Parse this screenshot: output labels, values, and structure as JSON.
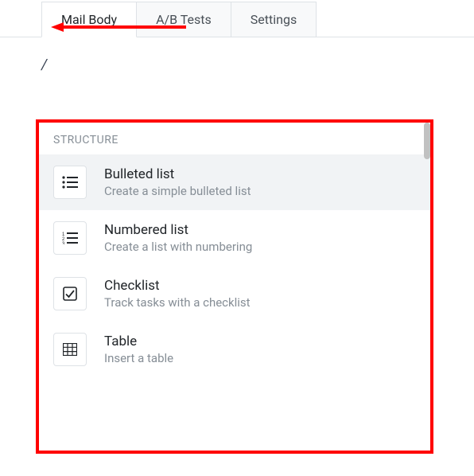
{
  "tabs": {
    "mail_body": "Mail Body",
    "ab_tests": "A/B Tests",
    "settings": "Settings"
  },
  "editor": {
    "slash": "/"
  },
  "popup": {
    "section_label": "STRUCTURE",
    "items": [
      {
        "title": "Bulleted list",
        "desc": "Create a simple bulleted list"
      },
      {
        "title": "Numbered list",
        "desc": "Create a list with numbering"
      },
      {
        "title": "Checklist",
        "desc": "Track tasks with a checklist"
      },
      {
        "title": "Table",
        "desc": "Insert a table"
      }
    ]
  }
}
